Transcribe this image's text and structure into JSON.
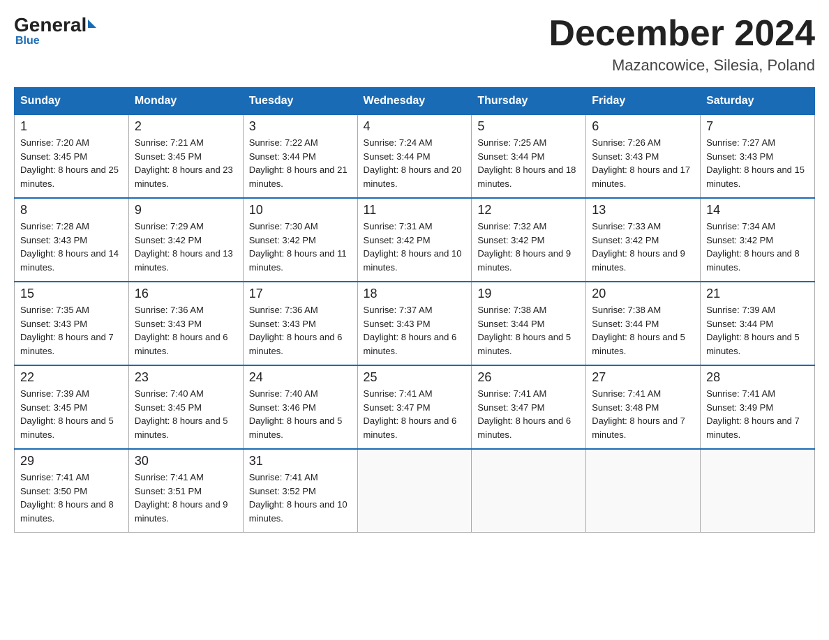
{
  "logo": {
    "general": "General",
    "blue": "Blue",
    "subtitle": "Blue"
  },
  "header": {
    "month": "December 2024",
    "location": "Mazancowice, Silesia, Poland"
  },
  "days_of_week": [
    "Sunday",
    "Monday",
    "Tuesday",
    "Wednesday",
    "Thursday",
    "Friday",
    "Saturday"
  ],
  "weeks": [
    [
      {
        "num": "1",
        "sunrise": "7:20 AM",
        "sunset": "3:45 PM",
        "daylight": "8 hours and 25 minutes."
      },
      {
        "num": "2",
        "sunrise": "7:21 AM",
        "sunset": "3:45 PM",
        "daylight": "8 hours and 23 minutes."
      },
      {
        "num": "3",
        "sunrise": "7:22 AM",
        "sunset": "3:44 PM",
        "daylight": "8 hours and 21 minutes."
      },
      {
        "num": "4",
        "sunrise": "7:24 AM",
        "sunset": "3:44 PM",
        "daylight": "8 hours and 20 minutes."
      },
      {
        "num": "5",
        "sunrise": "7:25 AM",
        "sunset": "3:44 PM",
        "daylight": "8 hours and 18 minutes."
      },
      {
        "num": "6",
        "sunrise": "7:26 AM",
        "sunset": "3:43 PM",
        "daylight": "8 hours and 17 minutes."
      },
      {
        "num": "7",
        "sunrise": "7:27 AM",
        "sunset": "3:43 PM",
        "daylight": "8 hours and 15 minutes."
      }
    ],
    [
      {
        "num": "8",
        "sunrise": "7:28 AM",
        "sunset": "3:43 PM",
        "daylight": "8 hours and 14 minutes."
      },
      {
        "num": "9",
        "sunrise": "7:29 AM",
        "sunset": "3:42 PM",
        "daylight": "8 hours and 13 minutes."
      },
      {
        "num": "10",
        "sunrise": "7:30 AM",
        "sunset": "3:42 PM",
        "daylight": "8 hours and 11 minutes."
      },
      {
        "num": "11",
        "sunrise": "7:31 AM",
        "sunset": "3:42 PM",
        "daylight": "8 hours and 10 minutes."
      },
      {
        "num": "12",
        "sunrise": "7:32 AM",
        "sunset": "3:42 PM",
        "daylight": "8 hours and 9 minutes."
      },
      {
        "num": "13",
        "sunrise": "7:33 AM",
        "sunset": "3:42 PM",
        "daylight": "8 hours and 9 minutes."
      },
      {
        "num": "14",
        "sunrise": "7:34 AM",
        "sunset": "3:42 PM",
        "daylight": "8 hours and 8 minutes."
      }
    ],
    [
      {
        "num": "15",
        "sunrise": "7:35 AM",
        "sunset": "3:43 PM",
        "daylight": "8 hours and 7 minutes."
      },
      {
        "num": "16",
        "sunrise": "7:36 AM",
        "sunset": "3:43 PM",
        "daylight": "8 hours and 6 minutes."
      },
      {
        "num": "17",
        "sunrise": "7:36 AM",
        "sunset": "3:43 PM",
        "daylight": "8 hours and 6 minutes."
      },
      {
        "num": "18",
        "sunrise": "7:37 AM",
        "sunset": "3:43 PM",
        "daylight": "8 hours and 6 minutes."
      },
      {
        "num": "19",
        "sunrise": "7:38 AM",
        "sunset": "3:44 PM",
        "daylight": "8 hours and 5 minutes."
      },
      {
        "num": "20",
        "sunrise": "7:38 AM",
        "sunset": "3:44 PM",
        "daylight": "8 hours and 5 minutes."
      },
      {
        "num": "21",
        "sunrise": "7:39 AM",
        "sunset": "3:44 PM",
        "daylight": "8 hours and 5 minutes."
      }
    ],
    [
      {
        "num": "22",
        "sunrise": "7:39 AM",
        "sunset": "3:45 PM",
        "daylight": "8 hours and 5 minutes."
      },
      {
        "num": "23",
        "sunrise": "7:40 AM",
        "sunset": "3:45 PM",
        "daylight": "8 hours and 5 minutes."
      },
      {
        "num": "24",
        "sunrise": "7:40 AM",
        "sunset": "3:46 PM",
        "daylight": "8 hours and 5 minutes."
      },
      {
        "num": "25",
        "sunrise": "7:41 AM",
        "sunset": "3:47 PM",
        "daylight": "8 hours and 6 minutes."
      },
      {
        "num": "26",
        "sunrise": "7:41 AM",
        "sunset": "3:47 PM",
        "daylight": "8 hours and 6 minutes."
      },
      {
        "num": "27",
        "sunrise": "7:41 AM",
        "sunset": "3:48 PM",
        "daylight": "8 hours and 7 minutes."
      },
      {
        "num": "28",
        "sunrise": "7:41 AM",
        "sunset": "3:49 PM",
        "daylight": "8 hours and 7 minutes."
      }
    ],
    [
      {
        "num": "29",
        "sunrise": "7:41 AM",
        "sunset": "3:50 PM",
        "daylight": "8 hours and 8 minutes."
      },
      {
        "num": "30",
        "sunrise": "7:41 AM",
        "sunset": "3:51 PM",
        "daylight": "8 hours and 9 minutes."
      },
      {
        "num": "31",
        "sunrise": "7:41 AM",
        "sunset": "3:52 PM",
        "daylight": "8 hours and 10 minutes."
      },
      null,
      null,
      null,
      null
    ]
  ]
}
